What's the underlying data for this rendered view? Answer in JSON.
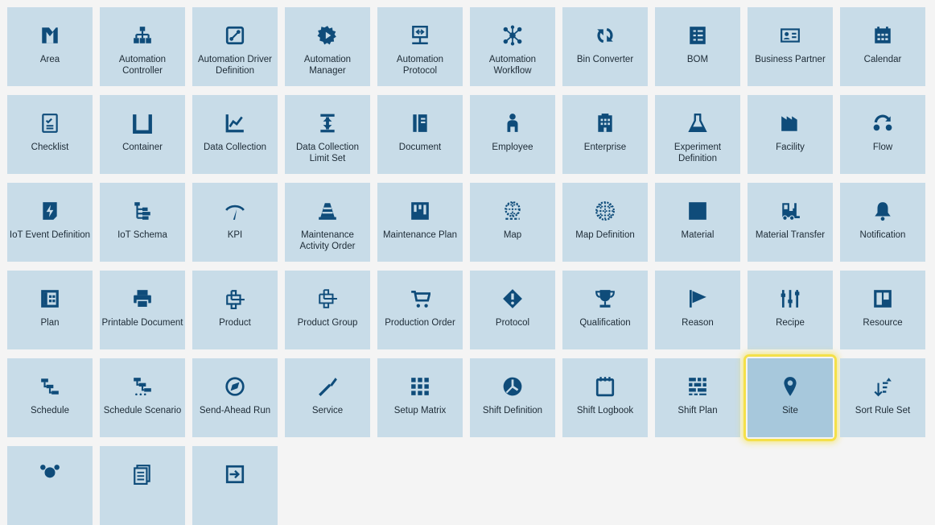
{
  "colors": {
    "tile": "#c8dce8",
    "tile_selected": "#a7c8dc",
    "icon": "#0f4c7a",
    "text": "#1d2b36",
    "highlight": "#f4e04a",
    "background": "#f4f4f4"
  },
  "selected": "Site",
  "tiles": [
    {
      "label": "Area",
      "icon": "area-icon"
    },
    {
      "label": "Automation Controller",
      "icon": "hierarchy-icon"
    },
    {
      "label": "Automation Driver Definition",
      "icon": "driver-icon"
    },
    {
      "label": "Automation Manager",
      "icon": "gear-play-icon"
    },
    {
      "label": "Automation Protocol",
      "icon": "protocol-monitor-icon"
    },
    {
      "label": "Automation Workflow",
      "icon": "workflow-network-icon"
    },
    {
      "label": "Bin Converter",
      "icon": "convert-arrows-icon"
    },
    {
      "label": "BOM",
      "icon": "bom-list-icon"
    },
    {
      "label": "Business Partner",
      "icon": "id-card-icon"
    },
    {
      "label": "Calendar",
      "icon": "calendar-icon"
    },
    {
      "label": "Checklist",
      "icon": "checklist-icon"
    },
    {
      "label": "Container",
      "icon": "container-icon"
    },
    {
      "label": "Data Collection",
      "icon": "line-chart-icon"
    },
    {
      "label": "Data Collection Limit Set",
      "icon": "limit-set-icon"
    },
    {
      "label": "Document",
      "icon": "document-icon"
    },
    {
      "label": "Employee",
      "icon": "person-icon"
    },
    {
      "label": "Enterprise",
      "icon": "building-icon"
    },
    {
      "label": "Experiment Definition",
      "icon": "flask-icon"
    },
    {
      "label": "Facility",
      "icon": "factory-icon"
    },
    {
      "label": "Flow",
      "icon": "flow-icon"
    },
    {
      "label": "IoT Event Definition",
      "icon": "iot-event-icon"
    },
    {
      "label": "IoT Schema",
      "icon": "schema-tree-icon"
    },
    {
      "label": "KPI",
      "icon": "gauge-icon"
    },
    {
      "label": "Maintenance Activity Order",
      "icon": "traffic-cone-icon"
    },
    {
      "label": "Maintenance Plan",
      "icon": "maintenance-plan-icon"
    },
    {
      "label": "Map",
      "icon": "map-globe-icon"
    },
    {
      "label": "Map Definition",
      "icon": "globe-icon"
    },
    {
      "label": "Material",
      "icon": "material-square-icon"
    },
    {
      "label": "Material Transfer",
      "icon": "forklift-icon"
    },
    {
      "label": "Notification",
      "icon": "bell-icon"
    },
    {
      "label": "Plan",
      "icon": "plan-icon"
    },
    {
      "label": "Printable Document",
      "icon": "printer-icon"
    },
    {
      "label": "Product",
      "icon": "product-icon"
    },
    {
      "label": "Product Group",
      "icon": "product-group-icon"
    },
    {
      "label": "Production Order",
      "icon": "cart-icon"
    },
    {
      "label": "Protocol",
      "icon": "diamond-alert-icon"
    },
    {
      "label": "Qualification",
      "icon": "trophy-icon"
    },
    {
      "label": "Reason",
      "icon": "flag-icon"
    },
    {
      "label": "Recipe",
      "icon": "sliders-icon"
    },
    {
      "label": "Resource",
      "icon": "resource-icon"
    },
    {
      "label": "Schedule",
      "icon": "schedule-icon"
    },
    {
      "label": "Schedule Scenario",
      "icon": "schedule-scenario-icon"
    },
    {
      "label": "Send-Ahead Run",
      "icon": "compass-icon"
    },
    {
      "label": "Service",
      "icon": "screwdriver-icon"
    },
    {
      "label": "Setup Matrix",
      "icon": "matrix-grid-icon"
    },
    {
      "label": "Shift Definition",
      "icon": "clock-icon"
    },
    {
      "label": "Shift Logbook",
      "icon": "logbook-icon"
    },
    {
      "label": "Shift Plan",
      "icon": "shift-plan-icon"
    },
    {
      "label": "Site",
      "icon": "map-pin-icon"
    },
    {
      "label": "Sort Rule Set",
      "icon": "sort-icon"
    },
    {
      "label": "",
      "icon": "network-icon"
    },
    {
      "label": "",
      "icon": "stacked-document-icon"
    },
    {
      "label": "",
      "icon": "transfer-box-icon"
    }
  ]
}
